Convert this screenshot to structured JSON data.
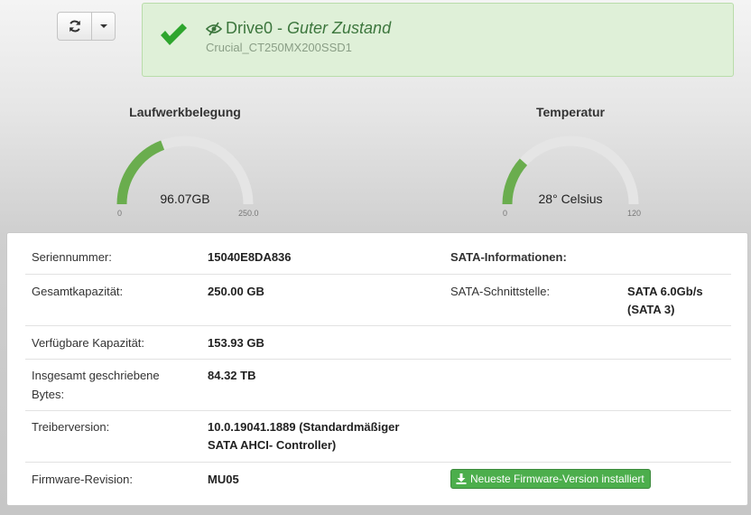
{
  "toolbar": {
    "refresh_icon": "refresh-icon",
    "dropdown_icon": "caret-down-icon"
  },
  "status": {
    "drive": "Drive0",
    "separator": " - ",
    "state": "Guter Zustand",
    "model": "Crucial_CT250MX200SSD1",
    "status_color": "#3c763d",
    "icon": "checkmark-icon"
  },
  "gauges": {
    "usage": {
      "title": "Laufwerkbelegung",
      "value_text": "96.07GB",
      "value": 96.07,
      "min": "0",
      "max": "250.0",
      "max_value": 250.0,
      "color": "#6aad4e"
    },
    "temperature": {
      "title": "Temperatur",
      "value_text": "28° Celsius",
      "value": 28,
      "min": "0",
      "max": "120",
      "max_value": 120,
      "color": "#6aad4e"
    }
  },
  "details": {
    "serial_label": "Seriennummer:",
    "serial_value": "15040E8DA836",
    "capacity_label": "Gesamtkapazität:",
    "capacity_value": "250.00 GB",
    "free_label": "Verfügbare Kapazität:",
    "free_value": "153.93 GB",
    "written_label_1": "Insgesamt geschriebene",
    "written_label_2": "Bytes:",
    "written_value": "84.32 TB",
    "driver_label": "Treiberversion:",
    "driver_value_1": "10.0.19041.1889 (Standardmäßiger",
    "driver_value_2": "SATA AHCI- Controller)",
    "firmware_label": "Firmware-Revision:",
    "firmware_value": "MU05",
    "sata_header": "SATA-Informationen:",
    "sata_iface_label": "SATA-Schnittstelle:",
    "sata_iface_value_1": "SATA 6.0Gb/s",
    "sata_iface_value_2": "(SATA 3)",
    "firmware_button": "Neueste Firmware-Version installiert"
  }
}
